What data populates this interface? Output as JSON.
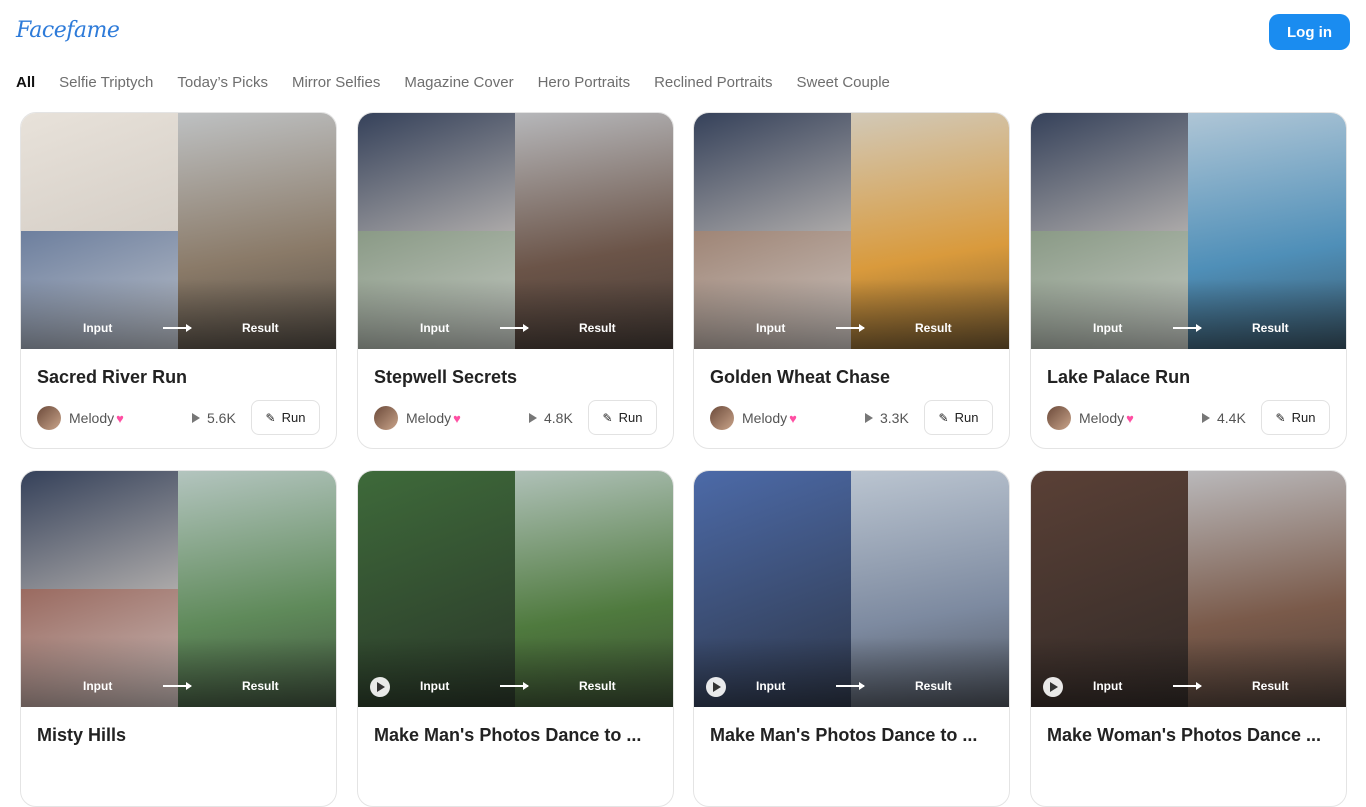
{
  "header": {
    "logo": "Facefame",
    "login_label": "Log in"
  },
  "tabs": [
    "All",
    "Selfie Triptych",
    "Today’s Picks",
    "Mirror Selfies",
    "Magazine Cover",
    "Hero Portraits",
    "Reclined Portraits",
    "Sweet Couple"
  ],
  "cards": [
    {
      "title": "Sacred River Run",
      "author": "Melody",
      "plays": "5.6K",
      "run_label": "Run",
      "input_label": "Input",
      "result_label": "Result",
      "video": false,
      "colors": {
        "lt": "#e8e2da",
        "lb": "#6d7f9e",
        "r": "#8a7a68"
      }
    },
    {
      "title": "Stepwell Secrets",
      "author": "Melody",
      "plays": "4.8K",
      "run_label": "Run",
      "input_label": "Input",
      "result_label": "Result",
      "video": false,
      "colors": {
        "lt": "#35415a",
        "lb": "#8a9a86",
        "r": "#6b5448"
      }
    },
    {
      "title": "Golden Wheat Chase",
      "author": "Melody",
      "plays": "3.3K",
      "run_label": "Run",
      "input_label": "Input",
      "result_label": "Result",
      "video": false,
      "colors": {
        "lt": "#35415a",
        "lb": "#9f8576",
        "r": "#d99a3c"
      }
    },
    {
      "title": "Lake Palace Run",
      "author": "Melody",
      "plays": "4.4K",
      "run_label": "Run",
      "input_label": "Input",
      "result_label": "Result",
      "video": false,
      "colors": {
        "lt": "#35415a",
        "lb": "#8a9a86",
        "r": "#4f8fb8"
      }
    },
    {
      "title": "Misty Hills",
      "author": "",
      "plays": "",
      "run_label": "",
      "input_label": "Input",
      "result_label": "Result",
      "video": false,
      "colors": {
        "lt": "#35415a",
        "lb": "#9a6a60",
        "r": "#5f8a5a"
      }
    },
    {
      "title": "Make Man's Photos Dance to ...",
      "author": "",
      "plays": "",
      "run_label": "",
      "input_label": "Input",
      "result_label": "Result",
      "video": true,
      "colors": {
        "lt": "#3e6a3a",
        "lb": "#3e6a3a",
        "r": "#4f7a3e"
      }
    },
    {
      "title": "Make Man's Photos Dance to ...",
      "author": "",
      "plays": "",
      "run_label": "",
      "input_label": "Input",
      "result_label": "Result",
      "video": true,
      "colors": {
        "lt": "#4c6aa8",
        "lb": "#4c6aa8",
        "r": "#7d8aa0"
      }
    },
    {
      "title": "Make Woman's Photos Dance ...",
      "author": "",
      "plays": "",
      "run_label": "",
      "input_label": "Input",
      "result_label": "Result",
      "video": true,
      "colors": {
        "lt": "#5a4036",
        "lb": "#5a4036",
        "r": "#7a5a4a"
      }
    }
  ]
}
